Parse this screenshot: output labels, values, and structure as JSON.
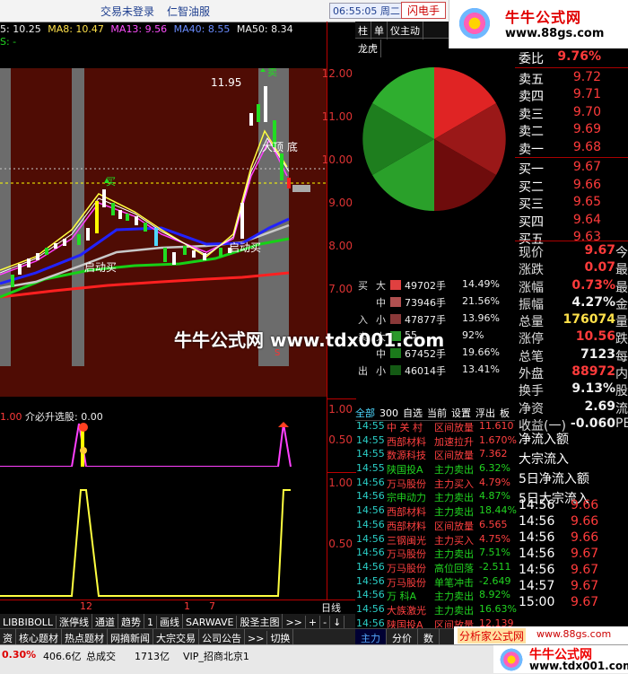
{
  "topbar": {
    "login": "交易未登录",
    "stock_name": "仁智油服",
    "time": "06:55:05 周二",
    "flash_button": "闪电手"
  },
  "logo": {
    "name": "牛牛公式网",
    "url": "www.88gs.com"
  },
  "ma_legend": {
    "ma5": "5: 10.25",
    "ma8": "MA8: 10.47",
    "ma13": "MA13: 9.56",
    "ma40": "MA40: 8.55",
    "ma50": "MA50: 8.34",
    "s_label": "S: -"
  },
  "main_chart": {
    "price_axis": [
      "12.00",
      "11.00",
      "10.00",
      "9.00",
      "8.00",
      "7.00"
    ],
    "high_label": "11.95",
    "annotations": {
      "buy_start_1": "启动买",
      "buy_start_2": "启动买",
      "big_bottom": "大顶 底",
      "sell": "卖",
      "buy": "买",
      "s": "S"
    },
    "colors": {
      "bg_band": "#5a0d05",
      "grey_band": "#6e6e6e"
    }
  },
  "watermark": "牛牛公式网 www.tdx001.com",
  "right_tabs": [
    "柱",
    "单",
    "仪主动",
    "龙虎"
  ],
  "pie": {
    "colors": {
      "red": "#d92020",
      "dark_red": "#7a0c0c",
      "green": "#1f9a1f",
      "dark_green": "#1c6f1c"
    }
  },
  "flow": {
    "rows": [
      {
        "side": "买",
        "size": "大",
        "vol": "49702手",
        "pct": "14.49%",
        "color": "#e04040"
      },
      {
        "side": "",
        "size": "中",
        "vol": "73946手",
        "pct": "21.56%",
        "color": "#c06060"
      },
      {
        "side": "入",
        "size": "小",
        "vol": "47877手",
        "pct": "13.96%",
        "color": "#a04848"
      },
      {
        "side": "卖",
        "size": "大",
        "vol": "55",
        "pct": "92%",
        "color": "#2a9a2a"
      },
      {
        "side": "",
        "size": "中",
        "vol": "67452手",
        "pct": "19.66%",
        "color": "#1b7a1b"
      },
      {
        "side": "出",
        "size": "小",
        "vol": "46014手",
        "pct": "13.41%",
        "color": "#145a14"
      }
    ]
  },
  "order_book": {
    "ratio_label": "委比",
    "ratio": "9.76%",
    "sells": [
      {
        "label": "卖五",
        "price": "9.72"
      },
      {
        "label": "卖四",
        "price": "9.71"
      },
      {
        "label": "卖三",
        "price": "9.70"
      },
      {
        "label": "卖二",
        "price": "9.69"
      },
      {
        "label": "卖一",
        "price": "9.68"
      }
    ],
    "buys": [
      {
        "label": "买一",
        "price": "9.67"
      },
      {
        "label": "买二",
        "price": "9.66"
      },
      {
        "label": "买三",
        "price": "9.65"
      },
      {
        "label": "买四",
        "price": "9.64"
      },
      {
        "label": "买五",
        "price": "9.63"
      }
    ]
  },
  "stats": [
    {
      "label": "现价",
      "value": "9.67",
      "color": "red",
      "right": "今"
    },
    {
      "label": "涨跌",
      "value": "0.07",
      "color": "red",
      "right": "最"
    },
    {
      "label": "涨幅",
      "value": "0.73%",
      "color": "red",
      "right": "最"
    },
    {
      "label": "振幅",
      "value": "4.27%",
      "color": "wht",
      "right": "金"
    },
    {
      "label": "总量",
      "value": "176074",
      "color": "yel",
      "right": "量"
    },
    {
      "label": "涨停",
      "value": "10.56",
      "color": "red",
      "right": "跌"
    },
    {
      "label": "总笔",
      "value": "7123",
      "color": "wht",
      "right": "每"
    },
    {
      "label": "外盘",
      "value": "88972",
      "color": "red",
      "right": "内"
    },
    {
      "label": "换手",
      "value": "9.13%",
      "color": "wht",
      "right": "股"
    },
    {
      "label": "净资",
      "value": "2.69",
      "color": "wht",
      "right": "流"
    },
    {
      "label": "收益(一)",
      "value": "-0.060",
      "color": "wht",
      "right": "PE"
    }
  ],
  "net_flow": [
    "净流入额",
    "大宗流入",
    "5日净流入额",
    "5日大宗流入"
  ],
  "ticks": [
    {
      "time": "14:56",
      "price": "9.66"
    },
    {
      "time": "14:56",
      "price": "9.66"
    },
    {
      "time": "14:56",
      "price": "9.66"
    },
    {
      "time": "14:56",
      "price": "9.67"
    },
    {
      "time": "14:56",
      "price": "9.67"
    },
    {
      "time": "14:57",
      "price": "9.67"
    },
    {
      "time": "15:00",
      "price": "9.67"
    }
  ],
  "alerts_head": [
    "全部",
    "300",
    "自选",
    "当前",
    "设置",
    "浮出",
    "板"
  ],
  "alerts": [
    {
      "time": "14:55",
      "name": "中 关 村",
      "kind": "区间放量",
      "val": "11.610"
    },
    {
      "time": "14:55",
      "name": "西部材料",
      "kind": "加速拉升",
      "val": "1.670%"
    },
    {
      "time": "14:55",
      "name": "数源科技",
      "kind": "区间放量",
      "val": "7.362"
    },
    {
      "time": "14:55",
      "name": "陕国投A",
      "kind": "主力卖出",
      "val": "6.32%"
    },
    {
      "time": "14:56",
      "name": "万马股份",
      "kind": "主力买入",
      "val": "4.79%"
    },
    {
      "time": "14:56",
      "name": "宗申动力",
      "kind": "主力卖出",
      "val": "4.87%"
    },
    {
      "time": "14:56",
      "name": "西部材料",
      "kind": "主力卖出",
      "val": "18.44%"
    },
    {
      "time": "14:56",
      "name": "西部材料",
      "kind": "区间放量",
      "val": "6.565"
    },
    {
      "time": "14:56",
      "name": "三钢闽光",
      "kind": "主力买入",
      "val": "4.75%"
    },
    {
      "time": "14:56",
      "name": "万马股份",
      "kind": "主力卖出",
      "val": "7.51%"
    },
    {
      "time": "14:56",
      "name": "万马股份",
      "kind": "高位回落",
      "val": "-2.511"
    },
    {
      "time": "14:56",
      "name": "万马股份",
      "kind": "单笔冲击",
      "val": "-2.649"
    },
    {
      "time": "14:56",
      "name": "万 科A",
      "kind": "主力卖出",
      "val": "8.92%"
    },
    {
      "time": "14:56",
      "name": "大族激光",
      "kind": "主力卖出",
      "val": "16.63%"
    },
    {
      "time": "14:56",
      "name": "陕国投A",
      "kind": "区间放量",
      "val": "12.139"
    },
    {
      "time": "14:56",
      "name": "滨海能源",
      "kind": "低位反弹",
      "val": "2.309%"
    },
    {
      "time": "14:56",
      "name": "滨海能源",
      "kind": "撑杆跳高",
      "val": "2.220%"
    }
  ],
  "indicator1": {
    "label_a": "1.00",
    "label_b": "介必升选股: 0.00",
    "axis": [
      "1.00",
      "0.50"
    ]
  },
  "indicator2": {
    "axis": [
      "1.00",
      "0.50"
    ]
  },
  "date_row": {
    "d1": "12",
    "d2": "1",
    "d3": "7",
    "period": "日线"
  },
  "ind_tabs": [
    "LIBBIBOLL",
    "涨停线",
    "通道",
    "趋势",
    "1",
    "画线",
    "SARWAVE",
    "股圣主图",
    ">>"
  ],
  "ind_tab_ctrls": [
    "+",
    "-",
    "↓"
  ],
  "cat_tabs": [
    "资",
    "核心题材",
    "热点题材",
    "网摘新闻",
    "大宗交易",
    "公司公告",
    ">>",
    "切换"
  ],
  "right_bottom_tabs": [
    "主力",
    "分价",
    "数"
  ],
  "bottom_logo": {
    "a": "分析家公式网",
    "b": "www.88gs.com"
  },
  "status": {
    "pct": "0.30%",
    "amount": "406.6亿",
    "label": "总成交",
    "total": "1713亿",
    "vip": "VIP_招商北京1"
  },
  "bottom_logo2": {
    "name": "牛牛公式网",
    "url": "www.tdx001.com"
  }
}
